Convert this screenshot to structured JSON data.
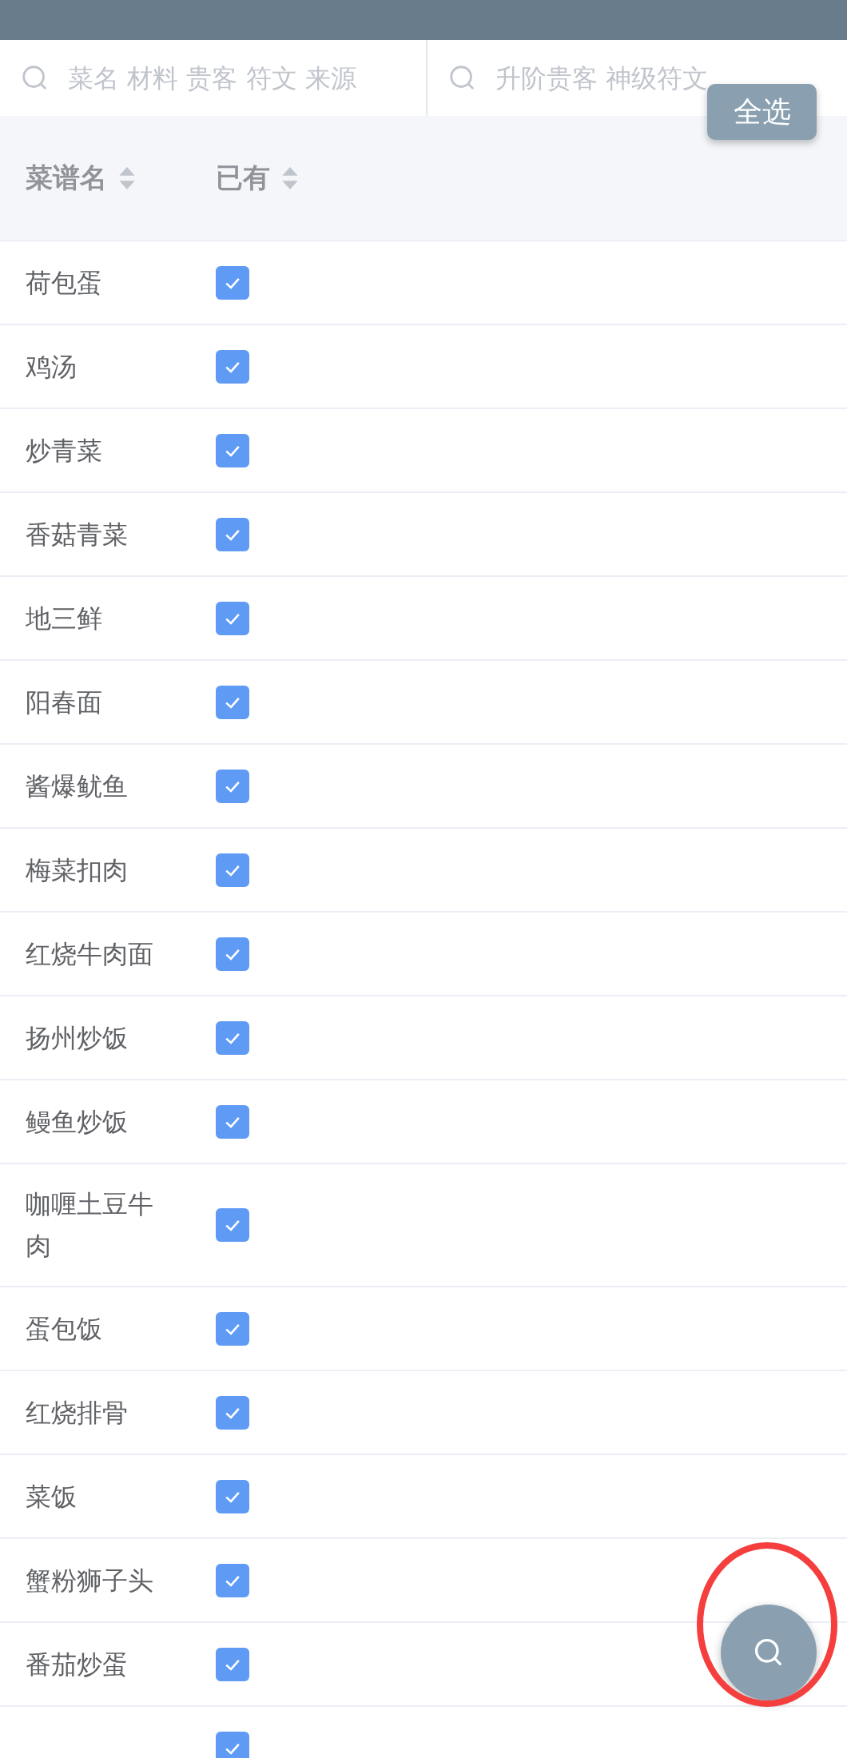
{
  "search_fields": [
    {
      "placeholder": "菜名 材料 贵客 符文 来源"
    },
    {
      "placeholder": "升阶贵客 神级符文"
    }
  ],
  "select_all_button": "全选",
  "table": {
    "columns": [
      {
        "label": "菜谱名"
      },
      {
        "label": "已有"
      }
    ],
    "rows": [
      {
        "name": "荷包蛋",
        "owned": true
      },
      {
        "name": "鸡汤",
        "owned": true
      },
      {
        "name": "炒青菜",
        "owned": true
      },
      {
        "name": "香菇青菜",
        "owned": true
      },
      {
        "name": "地三鲜",
        "owned": true
      },
      {
        "name": "阳春面",
        "owned": true
      },
      {
        "name": "酱爆鱿鱼",
        "owned": true
      },
      {
        "name": "梅菜扣肉",
        "owned": true
      },
      {
        "name": "红烧牛肉面",
        "owned": true
      },
      {
        "name": "扬州炒饭",
        "owned": true
      },
      {
        "name": "鳗鱼炒饭",
        "owned": true
      },
      {
        "name": "咖喱土豆牛肉",
        "owned": true
      },
      {
        "name": "蛋包饭",
        "owned": true
      },
      {
        "name": "红烧排骨",
        "owned": true
      },
      {
        "name": "菜饭",
        "owned": true
      },
      {
        "name": "蟹粉狮子头",
        "owned": true
      },
      {
        "name": "番茄炒蛋",
        "owned": true
      },
      {
        "owned": true
      }
    ]
  }
}
